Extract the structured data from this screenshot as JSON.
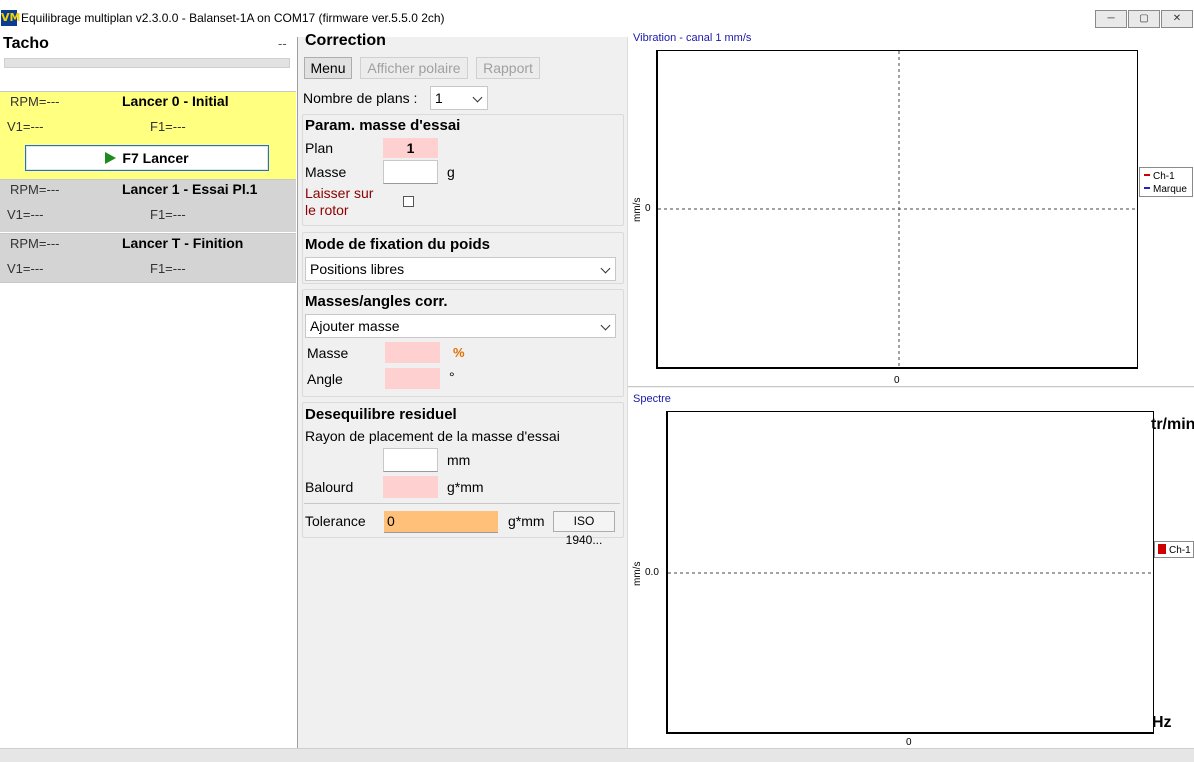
{
  "window": {
    "title": "Equilibrage multiplan v2.3.0.0 - Balanset-1A on COM17 (firmware ver.5.5.0 2ch)",
    "app_icon": "VM",
    "controls": [
      "minimize-icon",
      "maximize-icon",
      "close-icon"
    ]
  },
  "tacho": {
    "label": "Tacho",
    "value": "--"
  },
  "runs": [
    {
      "title": "Lancer 0 - Initial",
      "rpm_label": "RPM=",
      "rpm_value": "---",
      "v_label": "V1=",
      "v_value": "---",
      "f_label": "F1=",
      "f_value": "---",
      "active": true,
      "color": "#ffff80"
    },
    {
      "title": "Lancer 1 - Essai Pl.1",
      "rpm_label": "RPM=",
      "rpm_value": "---",
      "v_label": "V1=",
      "v_value": "---",
      "f_label": "F1=",
      "f_value": "---",
      "active": false,
      "color": "#d4d4d4"
    },
    {
      "title": "Lancer T - Finition",
      "rpm_label": "RPM=",
      "rpm_value": "---",
      "v_label": "V1=",
      "v_value": "---",
      "f_label": "F1=",
      "f_value": "---",
      "active": false,
      "color": "#d4d4d4"
    }
  ],
  "launch_button": "F7 Lancer",
  "correction": {
    "header": "Correction",
    "menu_button": "Menu",
    "polar_button": "Afficher polaire",
    "report_button": "Rapport",
    "planes_label": "Nombre de plans :",
    "planes_value": "1"
  },
  "trial_mass": {
    "header": "Param. masse d'essai",
    "plane_label": "Plan",
    "plane_value": "1",
    "mass_label": "Masse",
    "mass_value": "",
    "mass_unit": "g",
    "leave_label_1": "Laisser sur",
    "leave_label_2": "le rotor",
    "leave_checked": false
  },
  "fixation": {
    "header": "Mode de fixation du poids",
    "mode_value": "Positions libres"
  },
  "corr_masses": {
    "header": "Masses/angles corr.",
    "mode_value": "Ajouter masse",
    "mass_label": "Masse",
    "mass_unit": "%",
    "angle_label": "Angle",
    "angle_unit": "°"
  },
  "residual": {
    "header": "Desequilibre residuel",
    "radius_label": "Rayon de placement de la masse d'essai",
    "radius_value": "",
    "radius_unit": "mm",
    "unbalance_label": "Balourd",
    "unbalance_unit": "g*mm",
    "tolerance_label": "Tolerance",
    "tolerance_value": "0",
    "tolerance_unit": "g*mm",
    "iso_button": "ISO 1940..."
  },
  "vibration_chart": {
    "title": "Vibration - canal 1 mm/s",
    "ylabel": "mm/s",
    "y_zero": "0",
    "x_zero": "0",
    "legend": [
      {
        "name": "Ch-1",
        "color": "#cc0000"
      },
      {
        "name": "Marque",
        "color": "#2222cc"
      }
    ]
  },
  "spectrum_chart": {
    "title": "Spectre",
    "ylabel": "mm/s",
    "y_zero": "0.0",
    "x_zero": "0",
    "top_right_unit": "tr/min",
    "x_unit": "Hz",
    "legend": [
      {
        "name": "Ch-1",
        "color": "#cc0000"
      }
    ]
  },
  "colors": {
    "accent_blue": "#1a1aaa",
    "active_run_yellow": "#ffff80",
    "inactive_run_gray": "#d4d4d4",
    "pink_field": "#ffd0d0",
    "tolerance_orange": "#ffc07a",
    "leave_label_red": "#8b0000",
    "percent_orange": "#e07000"
  }
}
